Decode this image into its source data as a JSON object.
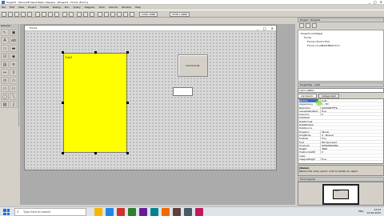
{
  "window": {
    "title": "Project1 - Microsoft Visual Basic [design] - [Project1 - Form1 (Form)]",
    "controls": [
      "_",
      "□",
      "✕"
    ]
  },
  "menu": [
    "File",
    "Edit",
    "View",
    "Project",
    "Format",
    "Debug",
    "Run",
    "Query",
    "Diagram",
    "Tools",
    "Add-Ins",
    "Window",
    "Help"
  ],
  "toolbar": {
    "position_readout": "1320, 1080",
    "size_readout": "3735 x 3660"
  },
  "toolbox": {
    "title": "General",
    "tools": [
      "↖",
      "▣",
      "A",
      "ab",
      "▭",
      "▬",
      "☑",
      "◉",
      "▤",
      "≡",
      "↔",
      "↕",
      "◷",
      "▭",
      "▭",
      "▭",
      "◯",
      "╲",
      "▧",
      "▯"
    ]
  },
  "form": {
    "title": "Form1",
    "listbox_item": "List1",
    "command_button": "Command1",
    "listbox_color": "#ffff00"
  },
  "project_explorer": {
    "title": "Project - Project1",
    "items": [
      "Project1 (Untitled)",
      "Forms",
      "Form1 (Form1.frm)",
      "Form1 (C:\\VB\\LISTBOX.frm)"
    ]
  },
  "properties": {
    "title": "Properties - List1",
    "object": "List1 ListBox",
    "tabs": [
      "Alphabetic",
      "Categorized"
    ],
    "rows": [
      {
        "name": "(Name)",
        "value": "List1"
      },
      {
        "name": "Appearance",
        "value": "1 - 3D"
      },
      {
        "name": "BackColor",
        "value": "&H0000FFFF&"
      },
      {
        "name": "CausesValidation",
        "value": "True"
      },
      {
        "name": "Columns",
        "value": "0"
      },
      {
        "name": "DataField",
        "value": ""
      },
      {
        "name": "DataFormat",
        "value": ""
      },
      {
        "name": "DataMember",
        "value": ""
      },
      {
        "name": "DataSource",
        "value": ""
      },
      {
        "name": "DragIcon",
        "value": "(None)"
      },
      {
        "name": "DragMode",
        "value": "0 - Manual"
      },
      {
        "name": "Enabled",
        "value": "True"
      },
      {
        "name": "Font",
        "value": "MS Sans Serif"
      },
      {
        "name": "ForeColor",
        "value": "&H80000008&"
      },
      {
        "name": "Height",
        "value": "3660"
      },
      {
        "name": "HelpContextID",
        "value": "0"
      },
      {
        "name": "Index",
        "value": ""
      },
      {
        "name": "IntegralHeight",
        "value": "True"
      }
    ],
    "description_name": "(Name)",
    "description_text": "Returns the name used in code to identify an object."
  },
  "form_layout": {
    "title": "Form Layout",
    "form_label": "Form1"
  },
  "taskbar": {
    "search_placeholder": "Type here to search",
    "search_icon": "search-icon",
    "apps": [
      "#f5b700",
      "#1e88e5",
      "#d32f2f",
      "#2e7d32",
      "#6a1b9a",
      "#00838f",
      "#ef6c00",
      "#5d4037",
      "#455a64",
      "#c2185b"
    ],
    "tray_text": "ENG",
    "time": "13:53",
    "date": "24-09-2020"
  }
}
